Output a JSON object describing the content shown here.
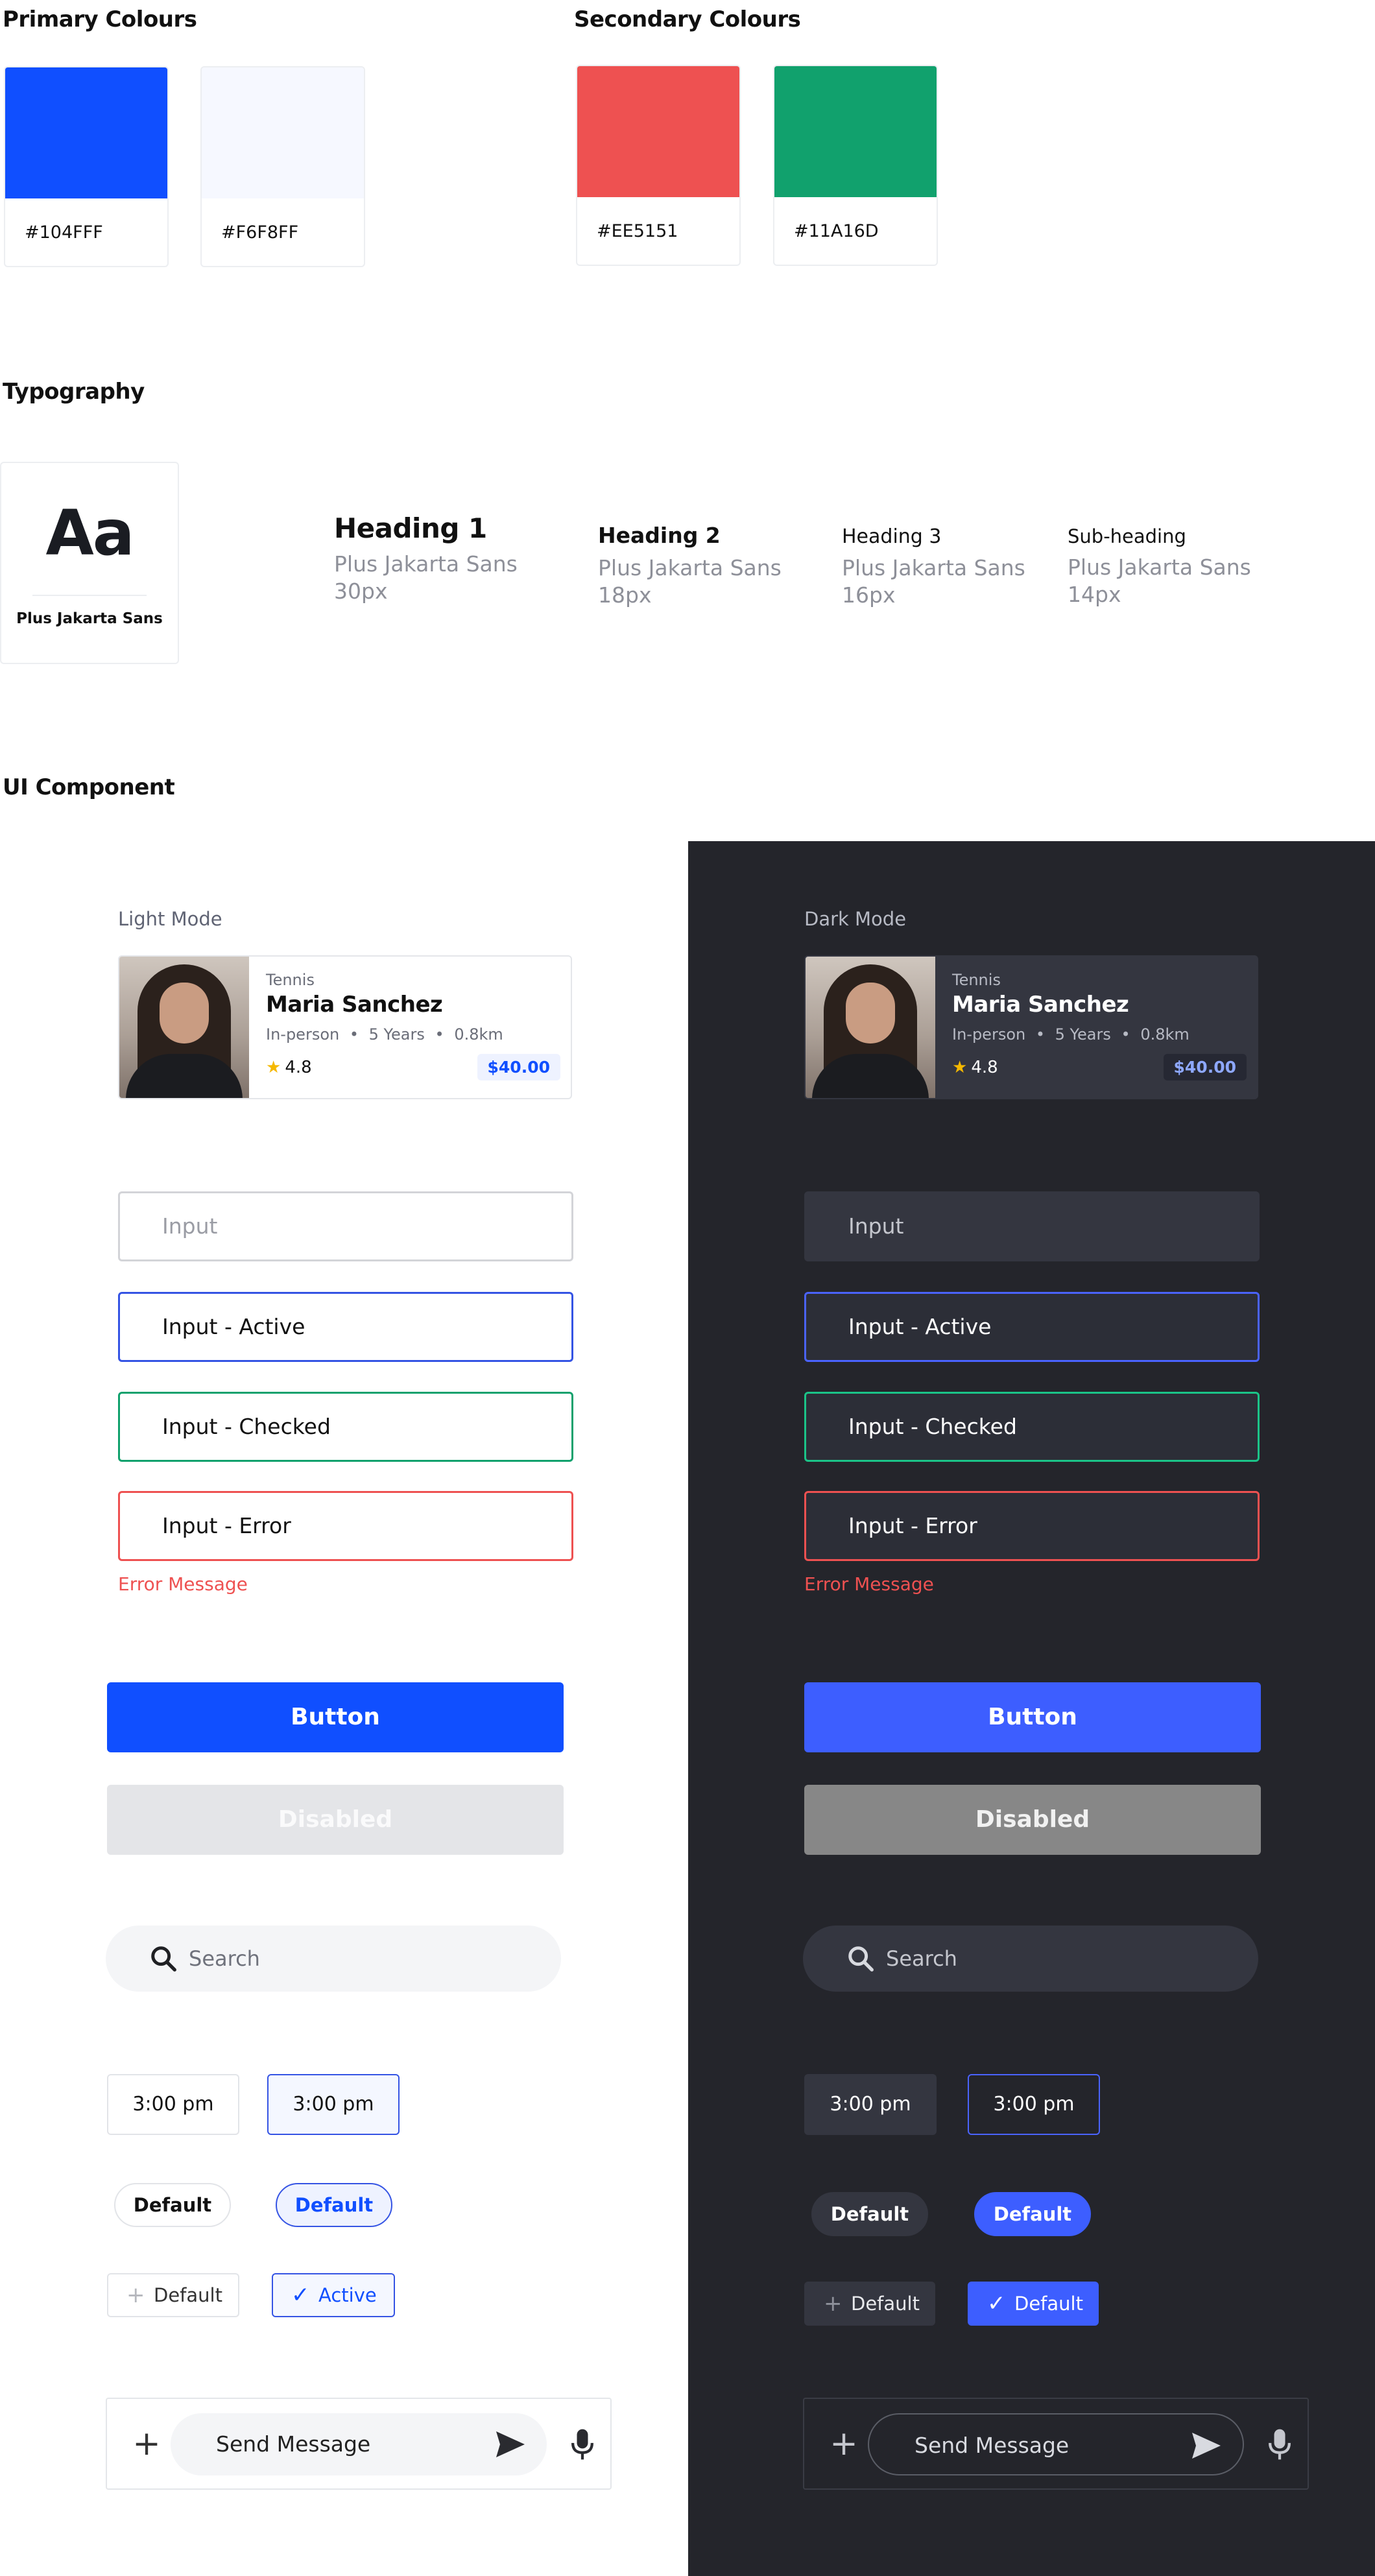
{
  "primary": {
    "title": "Primary Colours",
    "swatches": [
      {
        "hex": "#104FFF",
        "color": "#104fff"
      },
      {
        "hex": "#F6F8FF",
        "color": "#f6f8ff"
      }
    ]
  },
  "secondary": {
    "title": "Secondary Colours",
    "swatches": [
      {
        "hex": "#EE5151",
        "color": "#ee5151"
      },
      {
        "hex": "#11A16D",
        "color": "#11a16d"
      }
    ]
  },
  "typography": {
    "title": "Typography",
    "sample_glyph": "Aa",
    "font_name": "Plus Jakarta Sans",
    "styles": [
      {
        "name": "Heading 1",
        "font": "Plus Jakarta Sans",
        "size": "30px"
      },
      {
        "name": "Heading 2",
        "font": "Plus Jakarta Sans",
        "size": "18px"
      },
      {
        "name": "Heading 3",
        "font": "Plus Jakarta Sans",
        "size": "16px"
      },
      {
        "name": "Sub-heading",
        "font": "Plus Jakarta Sans",
        "size": "14px"
      }
    ]
  },
  "ui": {
    "title": "UI Component",
    "light": {
      "mode_label": "Light Mode"
    },
    "dark": {
      "mode_label": "Dark Mode"
    },
    "card": {
      "sport": "Tennis",
      "name": "Maria Sanchez",
      "type": "In-person",
      "experience": "5 Years",
      "distance": "0.8km",
      "separator": "•",
      "star": "★",
      "rating": "4.8",
      "price": "$40.00"
    },
    "inputs": {
      "default": "Input",
      "active": "Input - Active",
      "checked": "Input - Checked",
      "error": "Input - Error",
      "error_message": "Error Message"
    },
    "buttons": {
      "primary": "Button",
      "disabled": "Disabled"
    },
    "search": {
      "placeholder": "Search",
      "icon": "search-icon"
    },
    "time_slots": [
      "3:00 pm",
      "3:00 pm"
    ],
    "pills": [
      "Default",
      "Default"
    ],
    "tags": {
      "plus_glyph": "+",
      "check_glyph": "✓",
      "light": [
        "Default",
        "Active"
      ],
      "dark": [
        "Default",
        "Default"
      ]
    },
    "composer": {
      "plus_glyph": "+",
      "placeholder": "Send Message",
      "send_icon": "send-icon",
      "mic_icon": "microphone-icon"
    }
  }
}
